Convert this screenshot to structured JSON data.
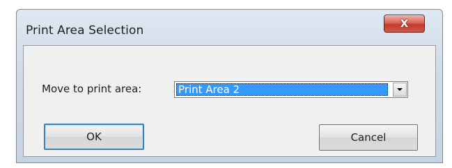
{
  "dialog": {
    "title": "Print Area Selection",
    "close_label": "X"
  },
  "form": {
    "move_label": "Move to print area:",
    "selected_area": "Print Area 2"
  },
  "buttons": {
    "ok_label": "OK",
    "cancel_label": "Cancel"
  },
  "colors": {
    "selection_highlight": "#3399ff",
    "close_button": "#c43a2b",
    "default_button_border": "#3c7fb1"
  },
  "icons": {
    "close": "close-icon",
    "dropdown": "chevron-down-icon"
  }
}
